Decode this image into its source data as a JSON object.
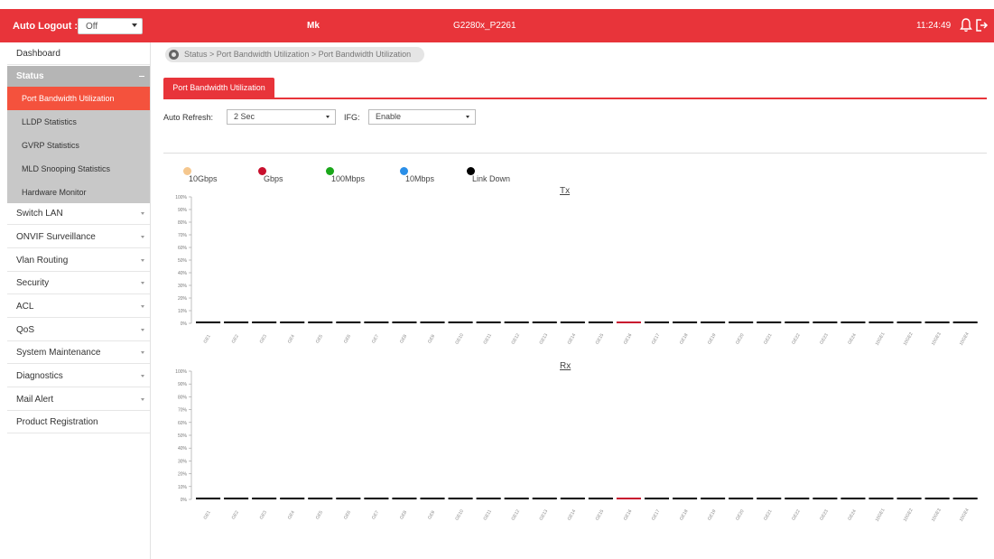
{
  "header": {
    "auto_logout_label": "Auto Logout :",
    "auto_logout_value": "Off",
    "device_name": "Mk",
    "model": "G2280x_P2261",
    "time": "11:24:49",
    "color": "#e8343a"
  },
  "sidebar": {
    "items": [
      {
        "label": "Dashboard"
      },
      {
        "label": "Status"
      },
      {
        "label": "Switch LAN"
      },
      {
        "label": "ONVIF Surveillance"
      },
      {
        "label": "Vlan Routing"
      },
      {
        "label": "Security"
      },
      {
        "label": "ACL"
      },
      {
        "label": "QoS"
      },
      {
        "label": "System Maintenance"
      },
      {
        "label": "Diagnostics"
      },
      {
        "label": "Mail Alert"
      },
      {
        "label": "Product Registration"
      }
    ],
    "status_sub": [
      {
        "label": "Port Bandwidth Utilization",
        "active": true
      },
      {
        "label": "LLDP Statistics"
      },
      {
        "label": "GVRP Statistics"
      },
      {
        "label": "MLD Snooping Statistics"
      },
      {
        "label": "Hardware Monitor"
      }
    ]
  },
  "breadcrumb": "Status > Port Bandwidth Utilization  > Port Bandwidth Utilization",
  "tab": {
    "label": "Port Bandwidth Utilization"
  },
  "controls": {
    "auto_refresh_label": "Auto Refresh:",
    "auto_refresh_value": "2 Sec",
    "ifg_label": "IFG:",
    "ifg_value": "Enable"
  },
  "legend": [
    {
      "label": "10Gbps",
      "color": "#f5c78e"
    },
    {
      "label": "Gbps",
      "color": "#c8102e"
    },
    {
      "label": "100Mbps",
      "color": "#1aa71a"
    },
    {
      "label": "10Mbps",
      "color": "#2b8fe8"
    },
    {
      "label": "Link Down",
      "color": "#000000"
    }
  ],
  "chart_data": [
    {
      "type": "bar",
      "title": "Tx",
      "categories": [
        "GE1",
        "GE2",
        "GE3",
        "GE4",
        "GE5",
        "GE6",
        "GE7",
        "GE8",
        "GE9",
        "GE10",
        "GE11",
        "GE12",
        "GE13",
        "GE14",
        "GE15",
        "GE16",
        "GE17",
        "GE18",
        "GE19",
        "GE20",
        "GE21",
        "GE22",
        "GE23",
        "GE24",
        "10GE1",
        "10GE2",
        "10GE3",
        "10GE4"
      ],
      "values": [
        0,
        0,
        0,
        0,
        0,
        0,
        0,
        0,
        0,
        0,
        0,
        0,
        0,
        0,
        0,
        0,
        0,
        0,
        0,
        0,
        0,
        0,
        0,
        0,
        0,
        0,
        0,
        0
      ],
      "status": [
        "Link Down",
        "Link Down",
        "Link Down",
        "Link Down",
        "Link Down",
        "Link Down",
        "Link Down",
        "Link Down",
        "Link Down",
        "Link Down",
        "Link Down",
        "Link Down",
        "Link Down",
        "Link Down",
        "Link Down",
        "Gbps",
        "Link Down",
        "Link Down",
        "Link Down",
        "Link Down",
        "Link Down",
        "Link Down",
        "Link Down",
        "Link Down",
        "Link Down",
        "Link Down",
        "Link Down",
        "Link Down"
      ],
      "yticks": [
        "100%",
        "90%",
        "80%",
        "70%",
        "60%",
        "50%",
        "40%",
        "30%",
        "20%",
        "10%",
        "0%"
      ],
      "ylim": [
        0,
        100
      ]
    },
    {
      "type": "bar",
      "title": "Rx",
      "categories": [
        "GE1",
        "GE2",
        "GE3",
        "GE4",
        "GE5",
        "GE6",
        "GE7",
        "GE8",
        "GE9",
        "GE10",
        "GE11",
        "GE12",
        "GE13",
        "GE14",
        "GE15",
        "GE16",
        "GE17",
        "GE18",
        "GE19",
        "GE20",
        "GE21",
        "GE22",
        "GE23",
        "GE24",
        "10GE1",
        "10GE2",
        "10GE3",
        "10GE4"
      ],
      "values": [
        0,
        0,
        0,
        0,
        0,
        0,
        0,
        0,
        0,
        0,
        0,
        0,
        0,
        0,
        0,
        0,
        0,
        0,
        0,
        0,
        0,
        0,
        0,
        0,
        0,
        0,
        0,
        0
      ],
      "status": [
        "Link Down",
        "Link Down",
        "Link Down",
        "Link Down",
        "Link Down",
        "Link Down",
        "Link Down",
        "Link Down",
        "Link Down",
        "Link Down",
        "Link Down",
        "Link Down",
        "Link Down",
        "Link Down",
        "Link Down",
        "Gbps",
        "Link Down",
        "Link Down",
        "Link Down",
        "Link Down",
        "Link Down",
        "Link Down",
        "Link Down",
        "Link Down",
        "Link Down",
        "Link Down",
        "Link Down",
        "Link Down"
      ],
      "yticks": [
        "100%",
        "90%",
        "80%",
        "70%",
        "60%",
        "50%",
        "40%",
        "30%",
        "20%",
        "10%",
        "0%"
      ],
      "ylim": [
        0,
        100
      ]
    }
  ]
}
